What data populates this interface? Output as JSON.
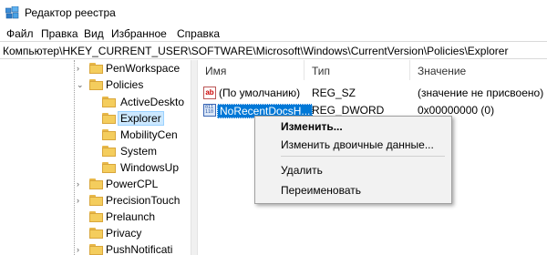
{
  "window": {
    "title": "Редактор реестра"
  },
  "menu": [
    "Файл",
    "Правка",
    "Вид",
    "Избранное",
    "Справка"
  ],
  "address": "Компьютер\\HKEY_CURRENT_USER\\SOFTWARE\\Microsoft\\Windows\\CurrentVersion\\Policies\\Explorer",
  "tree": {
    "items": [
      {
        "label": "PenWorkspace",
        "level": 1,
        "expander": "›",
        "selected": false
      },
      {
        "label": "Policies",
        "level": 1,
        "expander": "⌄",
        "selected": false
      },
      {
        "label": "ActiveDeskto",
        "level": 2,
        "expander": "",
        "selected": false
      },
      {
        "label": "Explorer",
        "level": 2,
        "expander": "",
        "selected": true
      },
      {
        "label": "MobilityCen",
        "level": 2,
        "expander": "",
        "selected": false
      },
      {
        "label": "System",
        "level": 2,
        "expander": "",
        "selected": false
      },
      {
        "label": "WindowsUp",
        "level": 2,
        "expander": "",
        "selected": false
      },
      {
        "label": "PowerCPL",
        "level": 1,
        "expander": "›",
        "selected": false
      },
      {
        "label": "PrecisionTouch",
        "level": 1,
        "expander": "›",
        "selected": false
      },
      {
        "label": "Prelaunch",
        "level": 1,
        "expander": "",
        "selected": false
      },
      {
        "label": "Privacy",
        "level": 1,
        "expander": "",
        "selected": false
      },
      {
        "label": "PushNotificati",
        "level": 1,
        "expander": "›",
        "selected": false
      }
    ]
  },
  "columns": {
    "name": "Имя",
    "type": "Тип",
    "value": "Значение"
  },
  "values": [
    {
      "icon": "string-value-icon",
      "icon_text": "ab",
      "name": "(По умолчанию)",
      "type": "REG_SZ",
      "data": "(значение не присвоено)",
      "selected": false
    },
    {
      "icon": "dword-value-icon",
      "icon_text": "011\n110",
      "name": "NoRecentDocsH...",
      "type": "REG_DWORD",
      "data": "0x00000000 (0)",
      "selected": true
    }
  ],
  "context_menu": {
    "modify": "Изменить...",
    "modify_binary": "Изменить двоичные данные...",
    "delete": "Удалить",
    "rename": "Переименовать"
  },
  "colors": {
    "selection": "#0078d7",
    "tree_selection": "#cce8ff",
    "folder": "#f4cd5d"
  }
}
